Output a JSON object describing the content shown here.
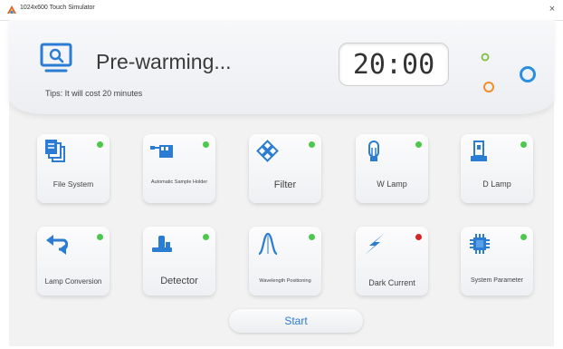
{
  "window": {
    "title": "1024x600 Touch Simulator",
    "close_label": "×"
  },
  "header": {
    "status": "Pre-warming...",
    "tips": "Tips: It will cost 20 minutes",
    "timer": "20:00"
  },
  "colors": {
    "accent": "#2b7cd3",
    "status_ok": "#4cc94c",
    "status_error": "#d62424",
    "deco_green": "#7bc043",
    "deco_orange": "#f28c28",
    "deco_blue": "#2b8fe0"
  },
  "tiles": [
    {
      "label": "File System",
      "icon": "file-stack-icon",
      "status": "green"
    },
    {
      "label": "Automatic Sample Holder",
      "icon": "sample-holder-icon",
      "status": "green"
    },
    {
      "label": "Filter",
      "icon": "filter-diamond-icon",
      "status": "green"
    },
    {
      "label": "W Lamp",
      "icon": "w-lamp-bulb-icon",
      "status": "green"
    },
    {
      "label": "D Lamp",
      "icon": "d-lamp-icon",
      "status": "green"
    },
    {
      "label": "Lamp Conversion",
      "icon": "swap-arrows-icon",
      "status": "green"
    },
    {
      "label": "Detector",
      "icon": "detector-icon",
      "status": "green"
    },
    {
      "label": "Wavelength Positioning",
      "icon": "peak-curve-icon",
      "status": "green"
    },
    {
      "label": "Dark Current",
      "icon": "lightning-icon",
      "status": "red"
    },
    {
      "label": "System Parameter",
      "icon": "chip-icon",
      "status": "green"
    }
  ],
  "start_label": "Start"
}
